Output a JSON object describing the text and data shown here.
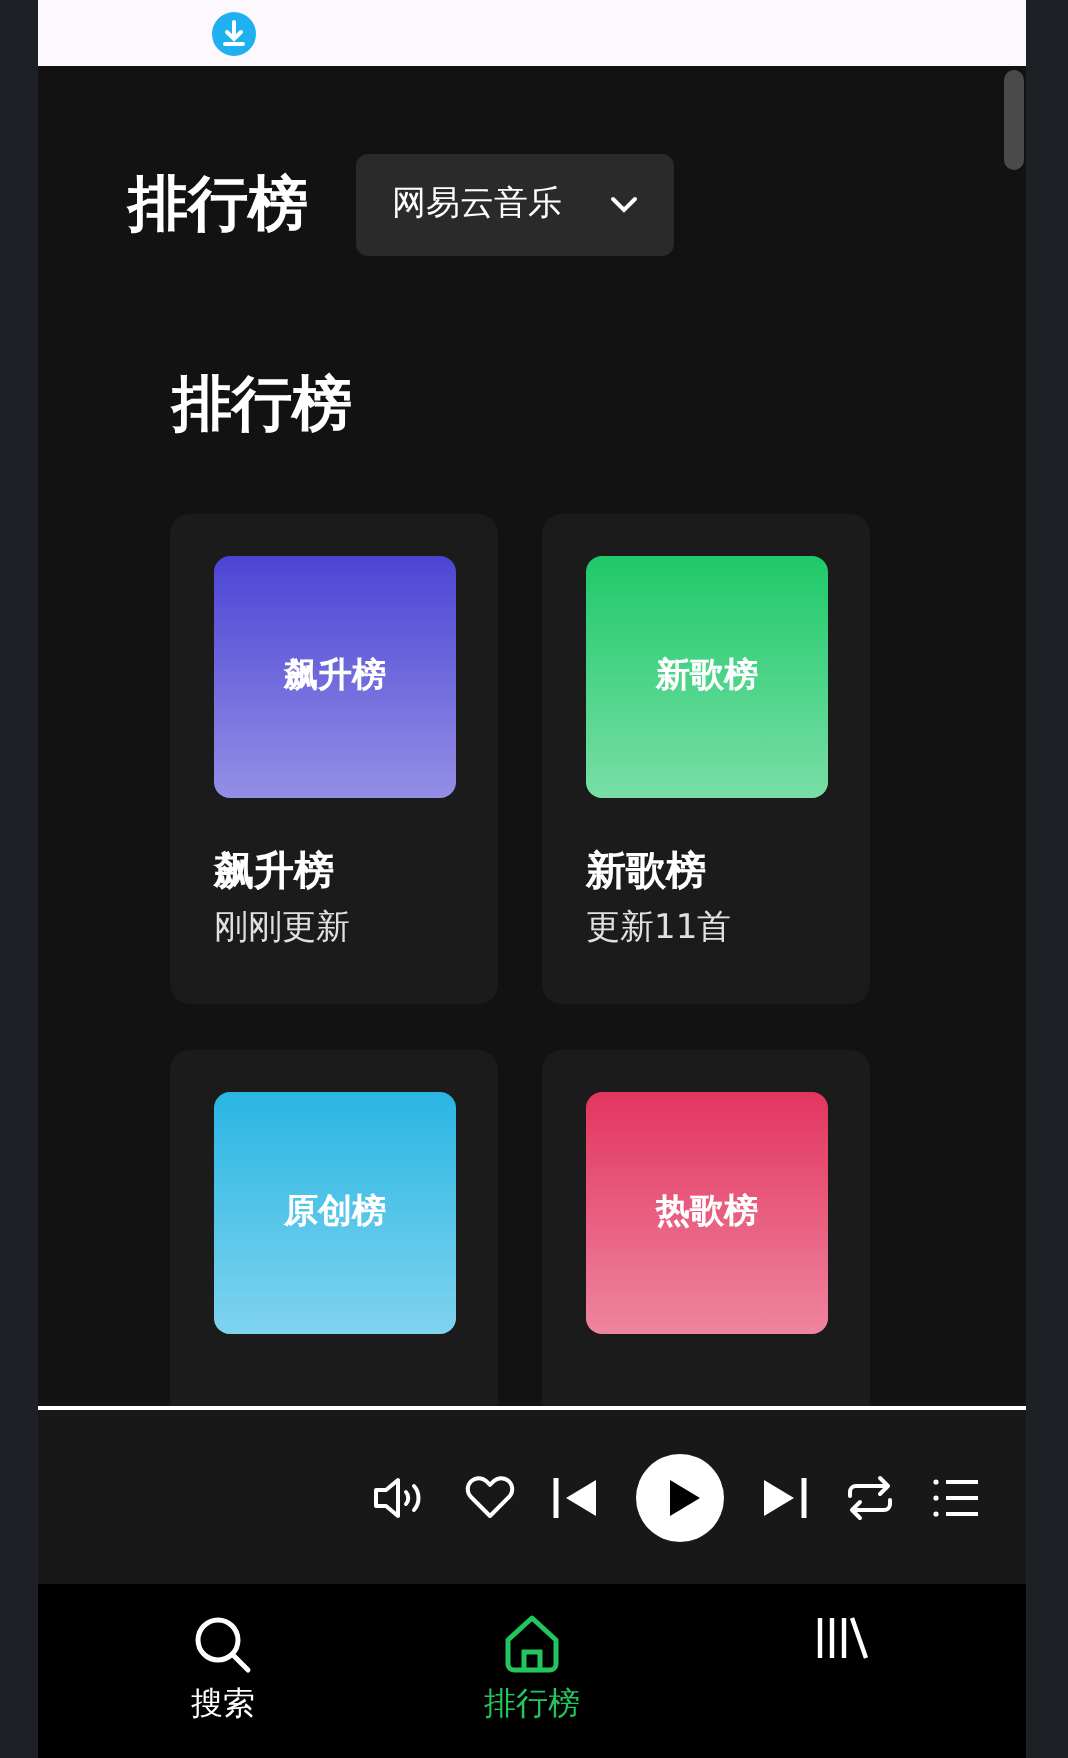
{
  "header": {
    "title": "排行榜",
    "source_dropdown": {
      "value": "网易云音乐"
    }
  },
  "section": {
    "title": "排行榜",
    "charts": [
      {
        "cover_label": "飙升榜",
        "title": "飙升榜",
        "subtitle": "刚刚更新",
        "color": "#4c45d4"
      },
      {
        "cover_label": "新歌榜",
        "title": "新歌榜",
        "subtitle": "更新11首",
        "color": "#1fc96a"
      },
      {
        "cover_label": "原创榜",
        "color": "#2ab6e4"
      },
      {
        "cover_label": "热歌榜",
        "color": "#e3355f"
      }
    ]
  },
  "bottom_nav": [
    {
      "kind": "search",
      "label": "搜索",
      "selected": false
    },
    {
      "kind": "home",
      "label": "排行榜",
      "selected": true
    },
    {
      "kind": "library",
      "selected": false
    }
  ]
}
